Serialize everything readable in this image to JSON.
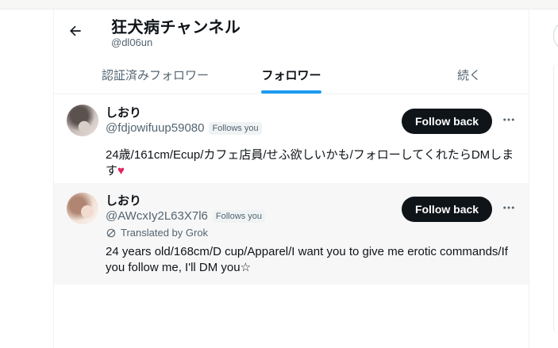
{
  "header": {
    "title": "狂犬病チャンネル",
    "handle": "@dl06un",
    "back_icon": "arrow-left-icon"
  },
  "tabs": [
    {
      "label": "認証済みフォロワー",
      "active": false
    },
    {
      "label": "フォロワー",
      "active": true
    },
    {
      "label": "続く",
      "active": false
    }
  ],
  "accent_color": "#1d9bf0",
  "users": [
    {
      "name": "しおり",
      "handle": "@fdjowifuup59080",
      "follows_you": "Follows you",
      "bio": "24歳/161cm/Ecup/カフェ店員/せふ欲しいかも/フォローしてくれたらDMします",
      "bio_emoji": "♥",
      "button": "Follow back"
    },
    {
      "name": "しおり",
      "handle": "@AWcxIy2L63X7l6",
      "follows_you": "Follows you",
      "translated": "Translated by Grok",
      "bio": "24 years old/168cm/D cup/Apparel/I want you to give me erotic commands/If you follow me, I'll DM you☆",
      "button": "Follow back"
    }
  ]
}
